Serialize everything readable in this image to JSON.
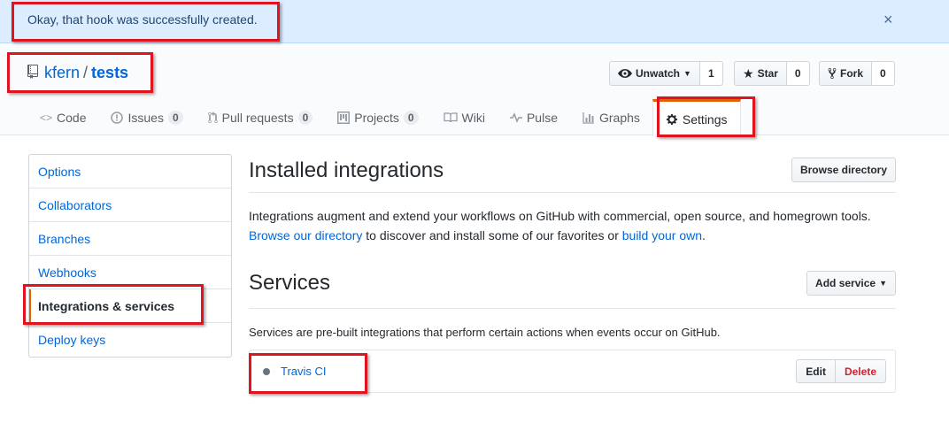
{
  "flash": {
    "message": "Okay, that hook was successfully created.",
    "close_icon": "×"
  },
  "repo": {
    "owner": "kfern",
    "separator": "/",
    "name": "tests"
  },
  "actions": {
    "watch_label": "Unwatch",
    "watch_count": "1",
    "star_label": "Star",
    "star_count": "0",
    "fork_label": "Fork",
    "fork_count": "0"
  },
  "tabs": [
    {
      "label": "Code",
      "icon": "code-icon"
    },
    {
      "label": "Issues",
      "count": "0",
      "icon": "issue-icon"
    },
    {
      "label": "Pull requests",
      "count": "0",
      "icon": "pull-request-icon"
    },
    {
      "label": "Projects",
      "count": "0",
      "icon": "project-icon"
    },
    {
      "label": "Wiki",
      "icon": "book-icon"
    },
    {
      "label": "Pulse",
      "icon": "pulse-icon"
    },
    {
      "label": "Graphs",
      "icon": "graph-icon"
    },
    {
      "label": "Settings",
      "icon": "gear-icon",
      "selected": true
    }
  ],
  "sidebar": {
    "items": [
      {
        "label": "Options"
      },
      {
        "label": "Collaborators"
      },
      {
        "label": "Branches"
      },
      {
        "label": "Webhooks"
      },
      {
        "label": "Integrations & services",
        "selected": true
      },
      {
        "label": "Deploy keys"
      }
    ]
  },
  "integrations": {
    "title": "Installed integrations",
    "browse_button": "Browse directory",
    "desc_line1": "Integrations augment and extend your workflows on GitHub with commercial, open source, and homegrown tools.",
    "desc_link1": "Browse our directory",
    "desc_mid": " to discover and install some of our favorites or ",
    "desc_link2": "build your own",
    "desc_end": "."
  },
  "services": {
    "title": "Services",
    "add_button": "Add service",
    "description": "Services are pre-built integrations that perform certain actions when events occur on GitHub.",
    "list": [
      {
        "name": "Travis CI",
        "edit_label": "Edit",
        "delete_label": "Delete"
      }
    ]
  },
  "colors": {
    "accent": "#e36209",
    "link": "#0366d6",
    "flash_bg": "#dbedff",
    "highlight": "#e0141e"
  }
}
